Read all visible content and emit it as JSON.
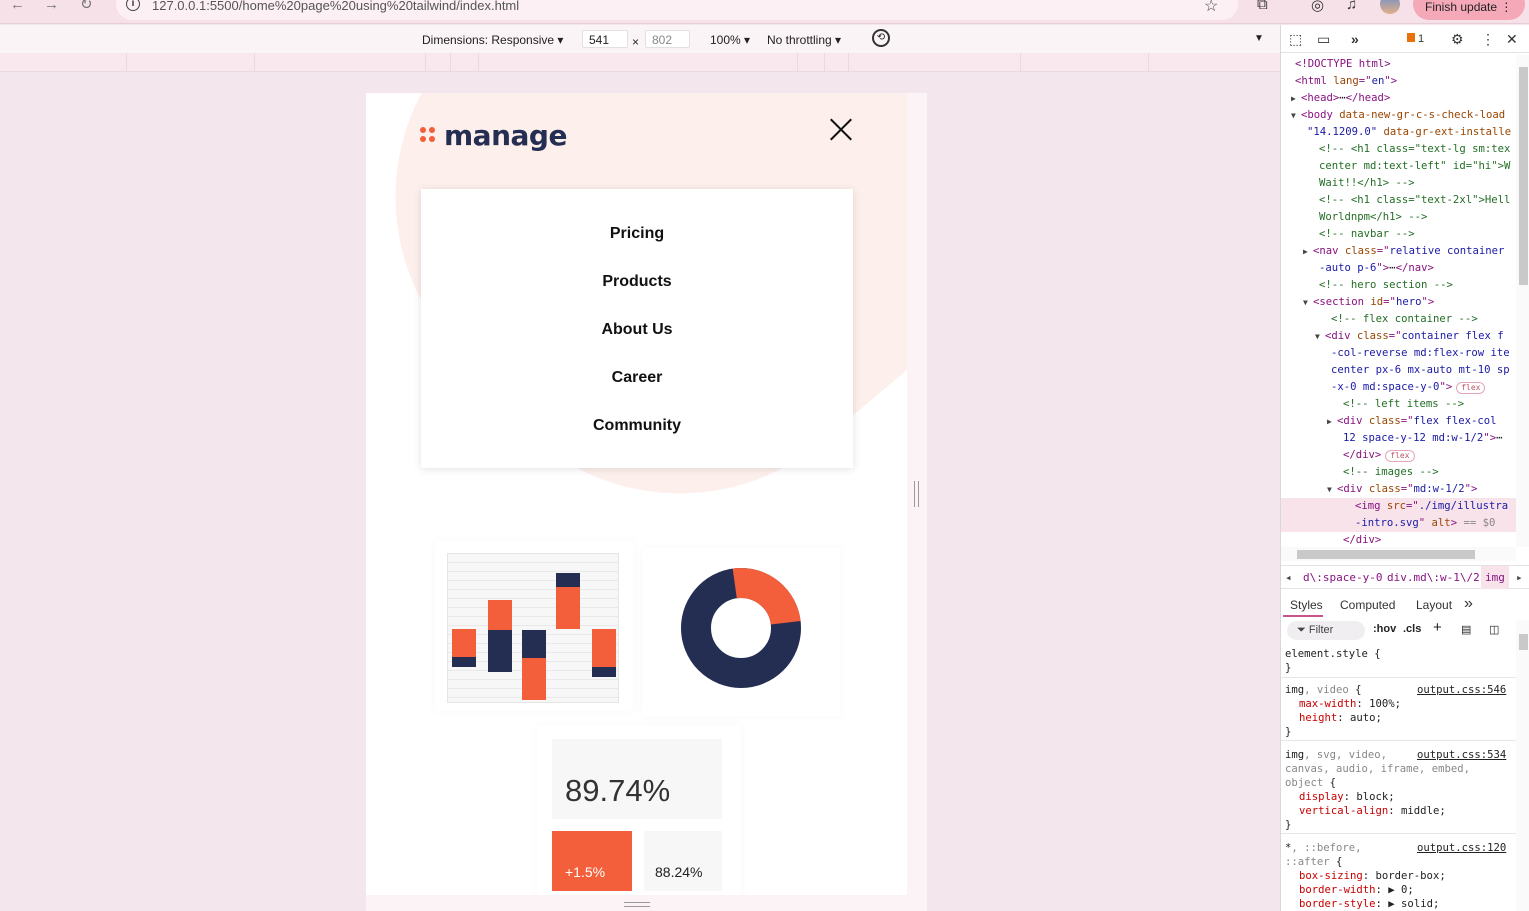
{
  "browser": {
    "url": "127.0.0.1:5500/home%20page%20using%20tailwind/index.html",
    "finish_update_label": "Finish update"
  },
  "device_toolbar": {
    "dimensions_label": "Dimensions: Responsive",
    "width_value": "541",
    "times": "×",
    "height_value": "802",
    "zoom_label": "100%",
    "throttling_label": "No throttling"
  },
  "site": {
    "logo_text": "manage",
    "menu_items": [
      "Pricing",
      "Products",
      "About Us",
      "Career",
      "Community"
    ],
    "stats": {
      "main_percent": "89.74%",
      "change": "+1.5%",
      "secondary_percent": "88.24%"
    },
    "colors": {
      "brand_orange": "#f25f3a",
      "brand_navy": "#242d52"
    }
  },
  "devtools": {
    "issue_count": "1",
    "dom_lines": [
      {
        "parts": [
          {
            "c": "tag",
            "t": "<!DOCTYPE html>"
          }
        ]
      },
      {
        "parts": [
          {
            "c": "tag",
            "t": "<html "
          },
          {
            "c": "attr",
            "t": "lang"
          },
          {
            "c": "tag",
            "t": "=\""
          },
          {
            "c": "val",
            "t": "en"
          },
          {
            "c": "tag",
            "t": "\">"
          }
        ]
      },
      {
        "parts": [
          {
            "c": "tag",
            "t": "<head>"
          },
          {
            "c": "txt",
            "t": "⋯"
          },
          {
            "c": "tag",
            "t": "</head>"
          }
        ]
      },
      {
        "parts": [
          {
            "c": "tag",
            "t": "<body "
          },
          {
            "c": "attr",
            "t": "data-new-gr-c-s-check-load"
          }
        ]
      },
      {
        "parts": [
          {
            "c": "val",
            "t": "\"14.1209.0\" "
          },
          {
            "c": "attr",
            "t": "data-gr-ext-installe"
          }
        ]
      },
      {
        "parts": [
          {
            "c": "cmt",
            "t": "<!-- <h1 class=\"text-lg sm:tex"
          }
        ]
      },
      {
        "parts": [
          {
            "c": "cmt",
            "t": "center md:text-left\" id=\"hi\">W"
          }
        ]
      },
      {
        "parts": [
          {
            "c": "cmt",
            "t": "Wait!!</h1> -->"
          }
        ]
      },
      {
        "parts": [
          {
            "c": "cmt",
            "t": "<!-- <h1 class=\"text-2xl\">Hell"
          }
        ]
      },
      {
        "parts": [
          {
            "c": "cmt",
            "t": "Worldnpm</h1> -->"
          }
        ]
      },
      {
        "parts": [
          {
            "c": "cmt",
            "t": "<!-- navbar  -->"
          }
        ]
      },
      {
        "parts": [
          {
            "c": "tag",
            "t": "<nav "
          },
          {
            "c": "attr",
            "t": "class"
          },
          {
            "c": "tag",
            "t": "=\""
          },
          {
            "c": "val",
            "t": "relative container"
          }
        ]
      },
      {
        "parts": [
          {
            "c": "val",
            "t": "-auto p-6"
          },
          {
            "c": "tag",
            "t": "\">"
          },
          {
            "c": "txt",
            "t": "⋯"
          },
          {
            "c": "tag",
            "t": "</nav>"
          }
        ]
      },
      {
        "parts": [
          {
            "c": "cmt",
            "t": "<!-- hero section -->"
          }
        ]
      },
      {
        "parts": [
          {
            "c": "tag",
            "t": "<section "
          },
          {
            "c": "attr",
            "t": "id"
          },
          {
            "c": "tag",
            "t": "=\""
          },
          {
            "c": "val",
            "t": "hero"
          },
          {
            "c": "tag",
            "t": "\">"
          }
        ]
      },
      {
        "parts": [
          {
            "c": "cmt",
            "t": "<!-- flex container -->"
          }
        ]
      },
      {
        "parts": [
          {
            "c": "tag",
            "t": "<div "
          },
          {
            "c": "attr",
            "t": "class"
          },
          {
            "c": "tag",
            "t": "=\""
          },
          {
            "c": "val",
            "t": "container flex f"
          }
        ]
      },
      {
        "parts": [
          {
            "c": "val",
            "t": "-col-reverse md:flex-row ite"
          }
        ]
      },
      {
        "parts": [
          {
            "c": "val",
            "t": "center px-6 mx-auto mt-10 sp"
          }
        ]
      },
      {
        "parts": [
          {
            "c": "val",
            "t": "-x-0 md:space-y-0"
          },
          {
            "c": "tag",
            "t": "\">"
          }
        ]
      },
      {
        "parts": [
          {
            "c": "cmt",
            "t": "<!-- left items -->"
          }
        ]
      },
      {
        "parts": [
          {
            "c": "tag",
            "t": "<div "
          },
          {
            "c": "attr",
            "t": "class"
          },
          {
            "c": "tag",
            "t": "=\""
          },
          {
            "c": "val",
            "t": "flex flex-col"
          }
        ]
      },
      {
        "parts": [
          {
            "c": "val",
            "t": "12 space-y-12 md:w-1/2"
          },
          {
            "c": "tag",
            "t": "\">"
          },
          {
            "c": "txt",
            "t": "⋯"
          }
        ]
      },
      {
        "parts": [
          {
            "c": "tag",
            "t": "</div>"
          }
        ]
      },
      {
        "parts": [
          {
            "c": "cmt",
            "t": "<!-- images -->"
          }
        ]
      },
      {
        "parts": [
          {
            "c": "tag",
            "t": "<div "
          },
          {
            "c": "attr",
            "t": "class"
          },
          {
            "c": "tag",
            "t": "=\""
          },
          {
            "c": "val",
            "t": "md:w-1/2"
          },
          {
            "c": "tag",
            "t": "\">"
          }
        ]
      },
      {
        "parts": [
          {
            "c": "tag",
            "t": "<img "
          },
          {
            "c": "attr",
            "t": "src"
          },
          {
            "c": "tag",
            "t": "=\""
          },
          {
            "c": "val",
            "t": "./img/illustra"
          }
        ]
      },
      {
        "parts": [
          {
            "c": "val",
            "t": "-intro.svg"
          },
          {
            "c": "tag",
            "t": "\" "
          },
          {
            "c": "attr",
            "t": "alt"
          },
          {
            "c": "tag",
            "t": ">"
          },
          {
            "c": "sel-dim",
            "t": " == $0"
          }
        ]
      },
      {
        "parts": [
          {
            "c": "tag",
            "t": "</div>"
          }
        ]
      }
    ],
    "flex_badge": "flex",
    "breadcrumbs": [
      "d\\:space-y-0",
      "div.md\\:w-1\\/2",
      "img"
    ],
    "style_tabs": [
      "Styles",
      "Computed",
      "Layout"
    ],
    "filter_label": "Filter",
    "hov_label": ":hov",
    "cls_label": ".cls",
    "style_lines": [
      {
        "parts": [
          {
            "c": "sel",
            "t": "element.style {"
          }
        ]
      },
      {
        "parts": [
          {
            "c": "sel",
            "t": "}"
          }
        ]
      },
      {
        "parts": [
          {
            "c": "sel",
            "t": "img"
          },
          {
            "c": "sel-dim",
            "t": ", video"
          },
          {
            "c": "sel",
            "t": " {"
          }
        ],
        "src": "output.css:546"
      },
      {
        "parts": [
          {
            "c": "prop",
            "t": "max-width"
          },
          {
            "c": "pval",
            "t": ": 100%;"
          }
        ],
        "indent": true
      },
      {
        "parts": [
          {
            "c": "prop",
            "t": "height"
          },
          {
            "c": "pval",
            "t": ": auto;"
          }
        ],
        "indent": true
      },
      {
        "parts": [
          {
            "c": "sel",
            "t": "}"
          }
        ]
      },
      {
        "parts": [
          {
            "c": "sel",
            "t": "img"
          },
          {
            "c": "sel-dim",
            "t": ", svg, video,"
          }
        ],
        "src": "output.css:534"
      },
      {
        "parts": [
          {
            "c": "sel-dim",
            "t": "canvas, audio, iframe, embed,"
          }
        ]
      },
      {
        "parts": [
          {
            "c": "sel-dim",
            "t": "object"
          },
          {
            "c": "sel",
            "t": " {"
          }
        ]
      },
      {
        "parts": [
          {
            "c": "prop",
            "t": "display"
          },
          {
            "c": "pval",
            "t": ": block;"
          }
        ],
        "indent": true
      },
      {
        "parts": [
          {
            "c": "prop",
            "t": "vertical-align"
          },
          {
            "c": "pval",
            "t": ": middle;"
          }
        ],
        "indent": true
      },
      {
        "parts": [
          {
            "c": "sel",
            "t": "}"
          }
        ]
      },
      {
        "parts": [
          {
            "c": "sel",
            "t": "*"
          },
          {
            "c": "sel-dim",
            "t": ", ::before,"
          }
        ],
        "src": "output.css:120"
      },
      {
        "parts": [
          {
            "c": "sel-dim",
            "t": "::after"
          },
          {
            "c": "sel",
            "t": " {"
          }
        ]
      },
      {
        "parts": [
          {
            "c": "prop",
            "t": "box-sizing"
          },
          {
            "c": "pval",
            "t": ": border-box;"
          }
        ],
        "indent": true
      },
      {
        "parts": [
          {
            "c": "prop",
            "t": "border-width"
          },
          {
            "c": "pval",
            "t": ": ▶ 0;"
          }
        ],
        "indent": true
      },
      {
        "parts": [
          {
            "c": "prop",
            "t": "border-style"
          },
          {
            "c": "pval",
            "t": ": ▶ solid;"
          }
        ],
        "indent": true
      }
    ]
  }
}
